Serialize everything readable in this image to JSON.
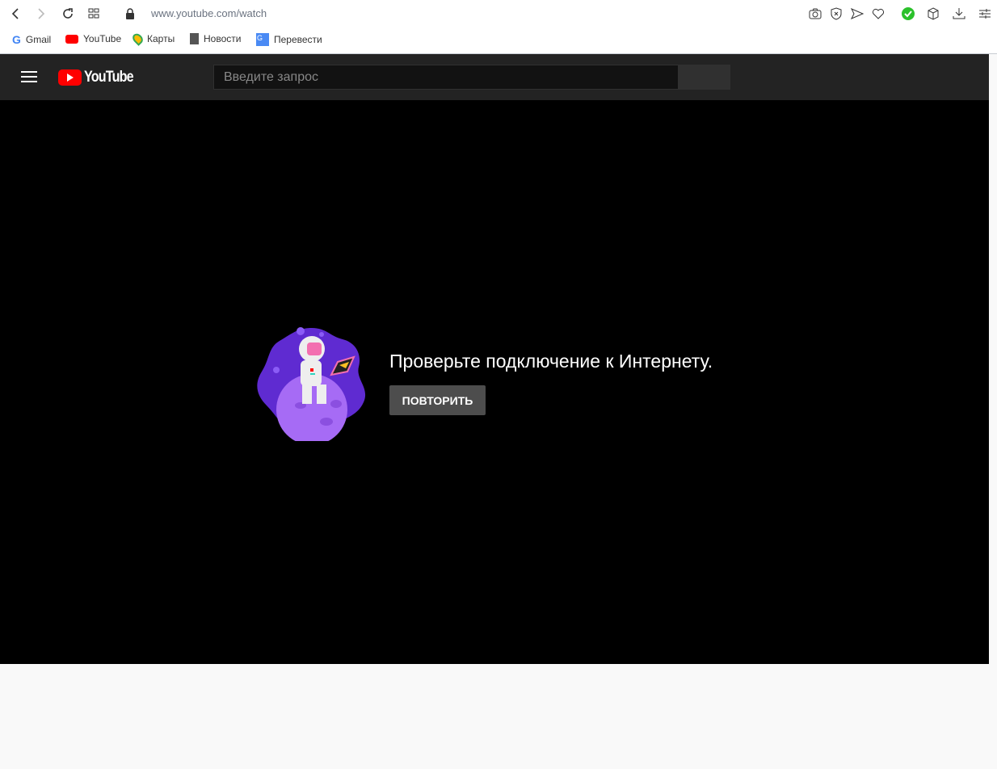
{
  "browser": {
    "url": "www.youtube.com/watch",
    "bookmarks": [
      {
        "label": "Gmail",
        "icon": "google-icon"
      },
      {
        "label": "YouTube",
        "icon": "youtube-icon"
      },
      {
        "label": "Карты",
        "icon": "maps-pin-icon"
      },
      {
        "label": "Новости",
        "icon": "document-icon"
      },
      {
        "label": "Перевести",
        "icon": "translate-icon"
      }
    ]
  },
  "youtube": {
    "logo": "YouTube",
    "search_placeholder": "Введите запрос"
  },
  "player": {
    "error_message": "Проверьте подключение к Интернету.",
    "retry_label": "ПОВТОРИТЬ"
  },
  "colors": {
    "accent_red": "#ff0000",
    "header_bg": "#232323",
    "retry_bg": "#4d4d4d",
    "status_green": "#2bc12b"
  }
}
